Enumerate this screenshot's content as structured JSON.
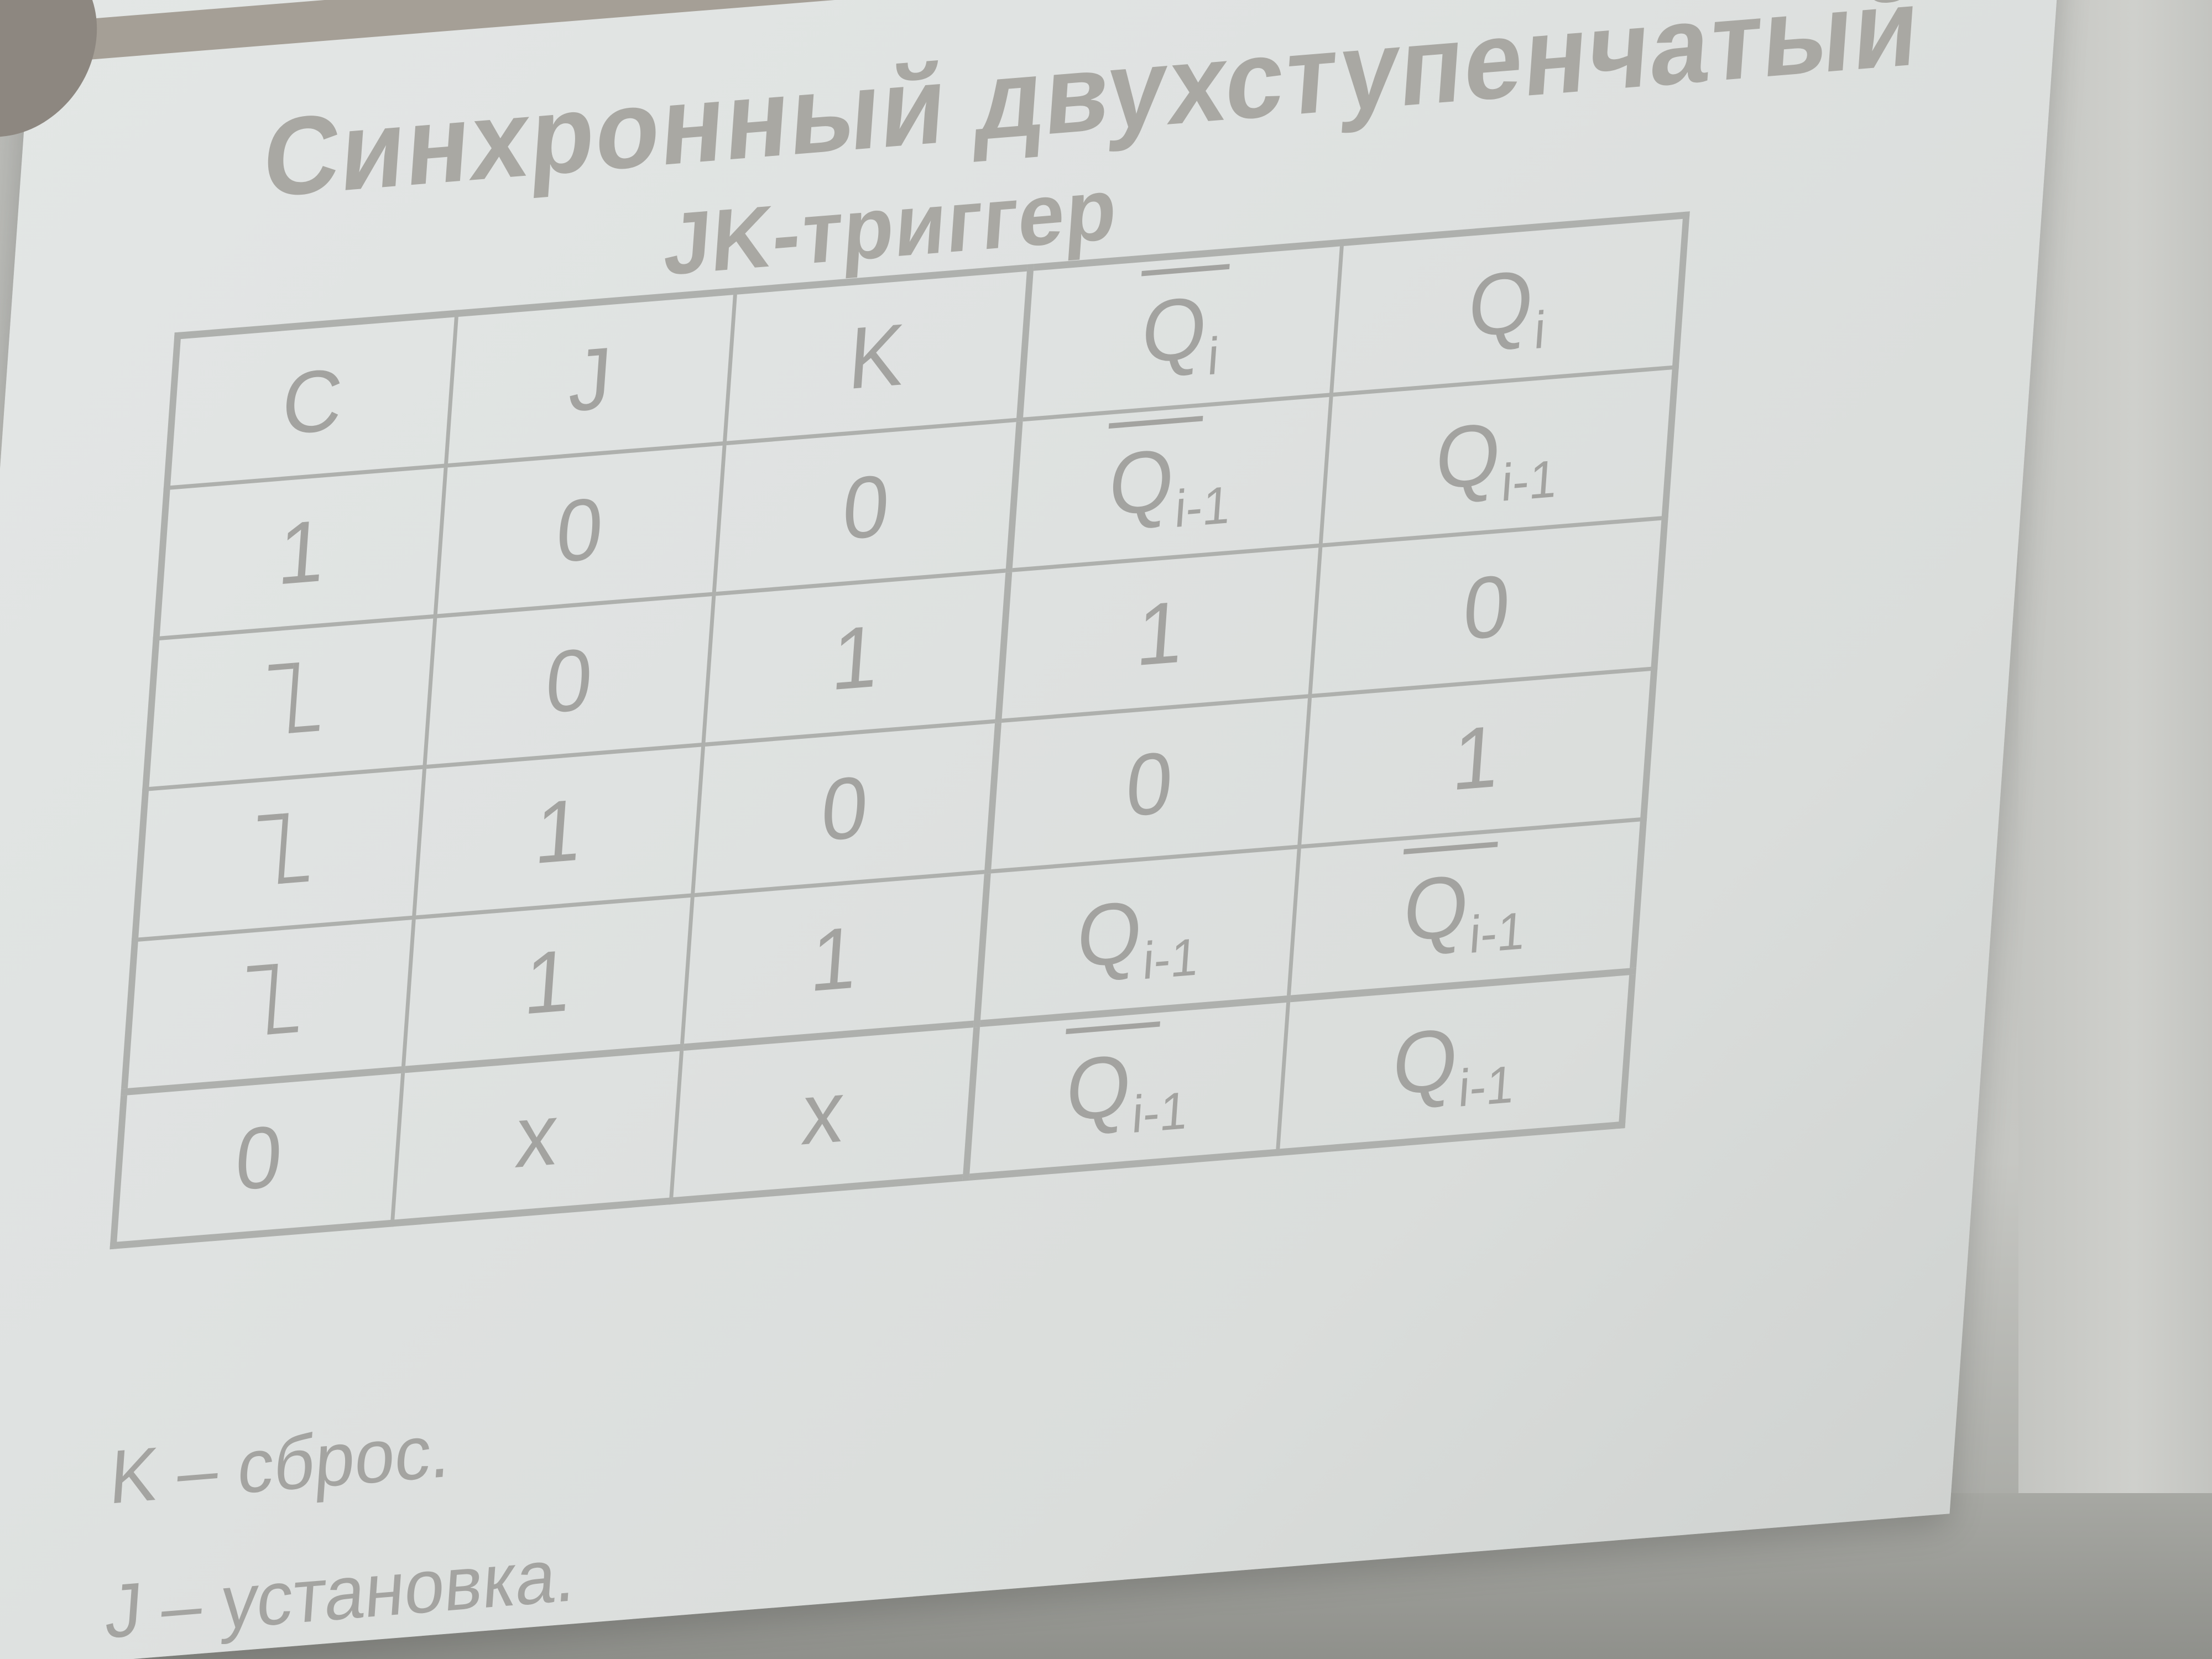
{
  "slide": {
    "title_line1": "Синхронный двухступенчатый",
    "title_line2": "JK-триггер",
    "table": {
      "headers": {
        "c": "C",
        "j": "J",
        "k": "K",
        "qbar_i": {
          "base": "Q",
          "sub": "i",
          "overline": true
        },
        "q_i": {
          "base": "Q",
          "sub": "i",
          "overline": false
        }
      },
      "rows": [
        {
          "c": "1",
          "j": "0",
          "k": "0",
          "qbar": {
            "base": "Q",
            "sub": "i-1",
            "overline": true
          },
          "q": {
            "base": "Q",
            "sub": "i-1",
            "overline": false
          }
        },
        {
          "c": "⌐falling",
          "c_icon": "falling-edge-icon",
          "j": "0",
          "k": "1",
          "qbar": "1",
          "q": "0"
        },
        {
          "c": "⌐falling",
          "c_icon": "falling-edge-icon",
          "j": "1",
          "k": "0",
          "qbar": "0",
          "q": "1"
        },
        {
          "c": "⌐falling",
          "c_icon": "falling-edge-icon",
          "j": "1",
          "k": "1",
          "qbar": {
            "base": "Q",
            "sub": "i-1",
            "overline": false
          },
          "q": {
            "base": "Q",
            "sub": "i-1",
            "overline": true
          }
        },
        {
          "c": "0",
          "j": "x",
          "k": "x",
          "qbar": {
            "base": "Q",
            "sub": "i-1",
            "overline": true
          },
          "q": {
            "base": "Q",
            "sub": "i-1",
            "overline": false
          }
        }
      ]
    },
    "notes": [
      "K – сброс.",
      "J – установка."
    ],
    "colors": {
      "slide_bg": "#e0e3e2",
      "text": "#a3a3a0",
      "accent_bar": "#a59f96"
    }
  }
}
